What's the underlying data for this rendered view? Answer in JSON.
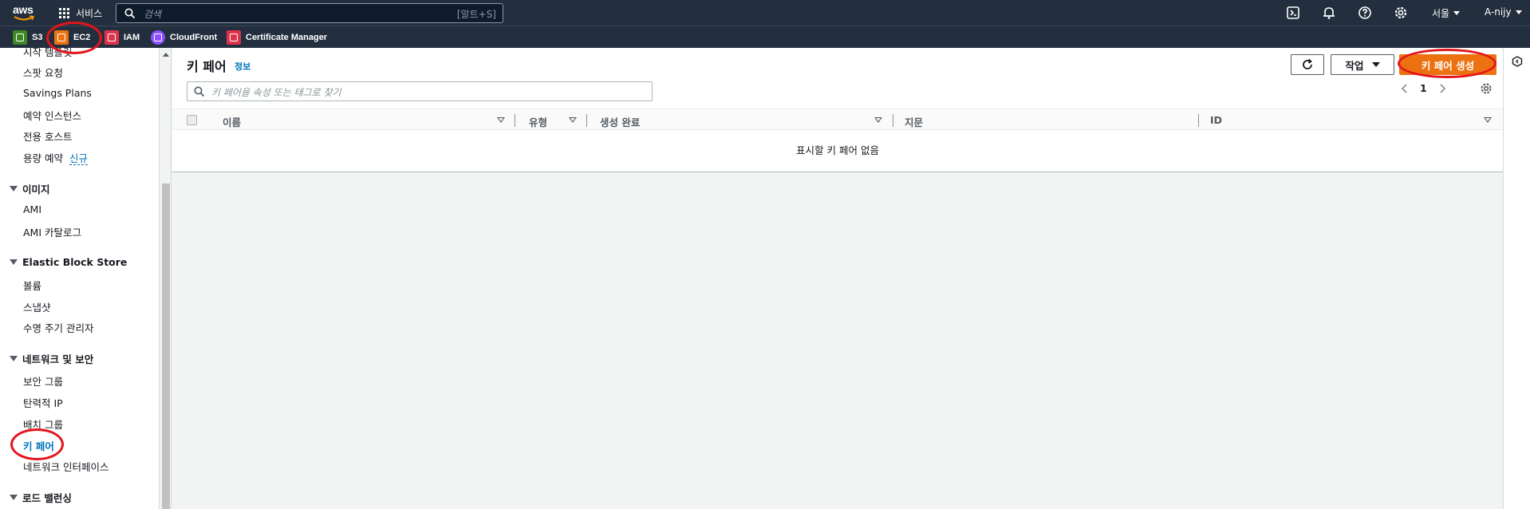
{
  "topnav": {
    "logo": "aws",
    "services_label": "서비스",
    "search_placeholder": "검색",
    "search_shortcut": "[알트+S]",
    "region": "서울",
    "account": "A-nijy",
    "icons": [
      "cloudshell-icon",
      "bell-icon",
      "help-icon",
      "settings-icon"
    ]
  },
  "favorites": [
    {
      "label": "S3",
      "color": "#3f8624"
    },
    {
      "label": "EC2",
      "color": "#ec7211"
    },
    {
      "label": "IAM",
      "color": "#dd344c"
    },
    {
      "label": "CloudFront",
      "color": "#8c4fff"
    },
    {
      "label": "Certificate Manager",
      "color": "#dd344c"
    }
  ],
  "sidebar": {
    "partial_top": "시작 템플릿",
    "items_top": [
      "스팟 요청",
      "Savings Plans",
      "예약 인스턴스",
      "전용 호스트",
      "용량 예약"
    ],
    "new_badge": "신규",
    "sections": [
      {
        "title": "이미지",
        "items": [
          "AMI",
          "AMI 카탈로그"
        ]
      },
      {
        "title": "Elastic Block Store",
        "items": [
          "볼륨",
          "스냅샷",
          "수명 주기 관리자"
        ]
      },
      {
        "title": "네트워크 및 보안",
        "items": [
          "보안 그룹",
          "탄력적 IP",
          "배치 그룹",
          "키 페어",
          "네트워크 인터페이스"
        ]
      },
      {
        "title": "로드 밸런싱",
        "items": []
      }
    ],
    "active_item": "키 페어"
  },
  "main": {
    "title": "키 페어",
    "info_link": "정보",
    "actions_label": "작업",
    "create_label": "키 페어 생성",
    "filter_placeholder": "키 페어을 속성 또는 태그로 찾기",
    "page_number": "1",
    "columns": [
      "이름",
      "유형",
      "생성 완료",
      "지문",
      "ID"
    ],
    "empty_message": "표시할 키 페어 없음"
  },
  "colors": {
    "nav_bg": "#232f3e",
    "primary_button": "#ec7211",
    "link": "#0073bb",
    "annotation": "#e4141b"
  }
}
